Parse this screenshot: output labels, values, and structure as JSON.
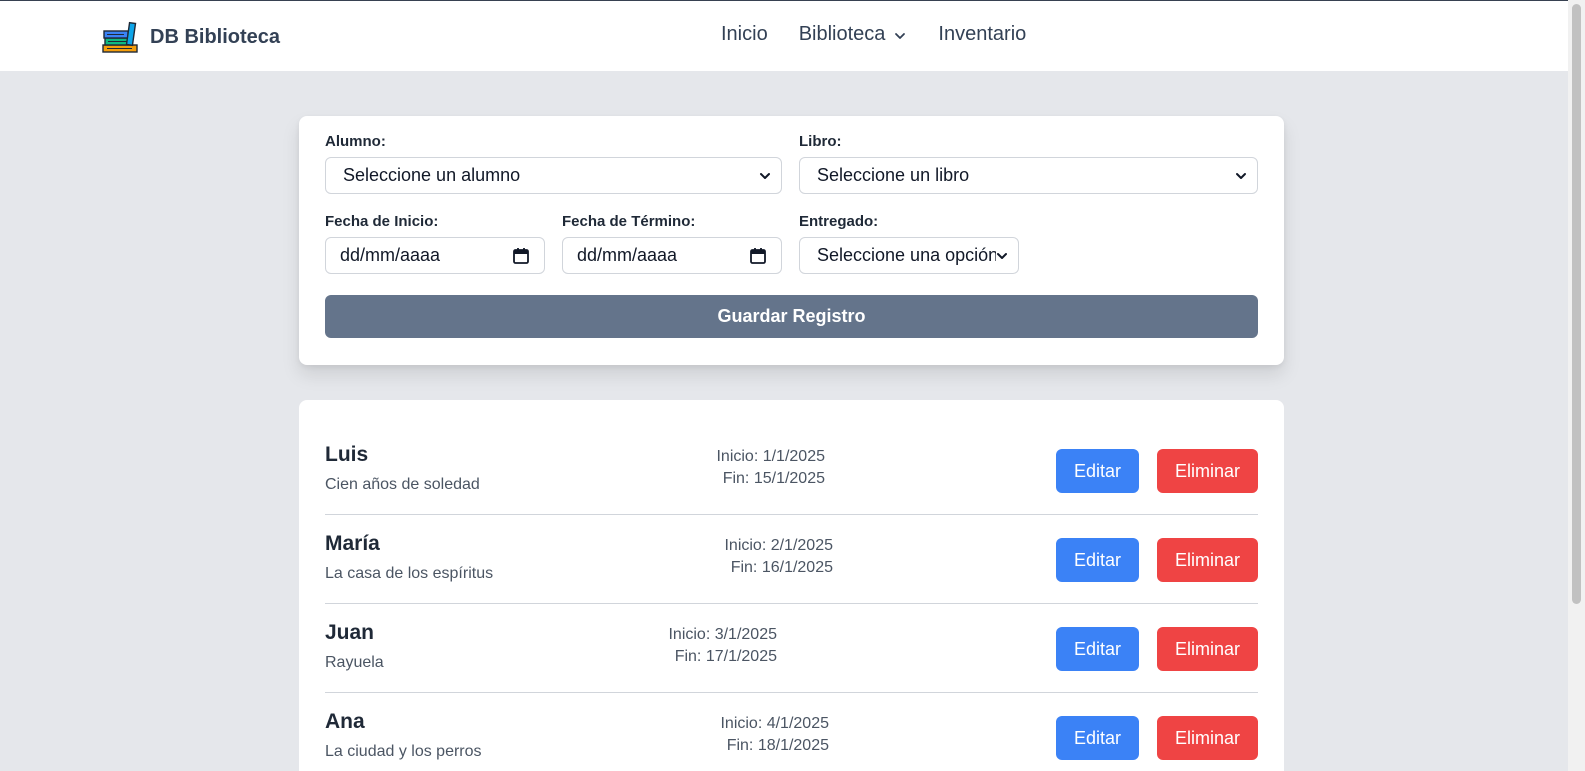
{
  "navbar": {
    "brand": "DB Biblioteca",
    "brand_icon": "books-stack-icon",
    "links": {
      "inicio": "Inicio",
      "biblioteca": "Biblioteca",
      "inventario": "Inventario"
    }
  },
  "form": {
    "alumno_label": "Alumno:",
    "alumno_value": "Seleccione un alumno",
    "libro_label": "Libro:",
    "libro_value": "Seleccione un libro",
    "fecha_inicio_label": "Fecha de Inicio:",
    "fecha_inicio_value": "dd/mm/aaaa",
    "fecha_termino_label": "Fecha de Término:",
    "fecha_termino_value": "dd/mm/aaaa",
    "entregado_label": "Entregado:",
    "entregado_value": "Seleccione una opción",
    "save_label": "Guardar Registro"
  },
  "records": [
    {
      "name": "Luis",
      "book": "Cien años de soledad",
      "inicio": "Inicio: 1/1/2025",
      "fin": "Fin: 15/1/2025",
      "edit": "Editar",
      "delete": "Eliminar"
    },
    {
      "name": "María",
      "book": "La casa de los espíritus",
      "inicio": "Inicio: 2/1/2025",
      "fin": "Fin: 16/1/2025",
      "edit": "Editar",
      "delete": "Eliminar"
    },
    {
      "name": "Juan",
      "book": "Rayuela",
      "inicio": "Inicio: 3/1/2025",
      "fin": "Fin: 17/1/2025",
      "edit": "Editar",
      "delete": "Eliminar"
    },
    {
      "name": "Ana",
      "book": "La ciudad y los perros",
      "inicio": "Inicio: 4/1/2025",
      "fin": "Fin: 18/1/2025",
      "edit": "Editar",
      "delete": "Eliminar"
    }
  ],
  "colors": {
    "edit": "#3b82f6",
    "delete": "#ef4444",
    "save": "#64748b",
    "background": "#e5e7eb"
  }
}
